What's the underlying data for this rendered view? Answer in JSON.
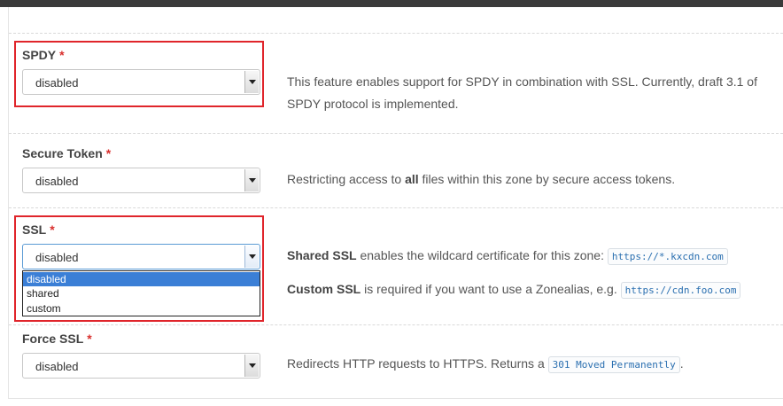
{
  "fields": {
    "spdy": {
      "label": "SPDY",
      "required_mark": "*",
      "value": "disabled",
      "description": "This feature enables support for SPDY in combination with SSL. Currently, draft 3.1 of SPDY protocol is implemented."
    },
    "secure_token": {
      "label": "Secure Token",
      "required_mark": "*",
      "value": "disabled",
      "description_pre": "Restricting access to ",
      "description_bold": "all",
      "description_post": " files within this zone by secure access tokens."
    },
    "ssl": {
      "label": "SSL",
      "required_mark": "*",
      "value": "disabled",
      "options": [
        "disabled",
        "shared",
        "custom"
      ],
      "shared_bold": "Shared SSL",
      "shared_text": " enables the wildcard certificate for this zone: ",
      "shared_code": "https://*.kxcdn.com",
      "custom_bold": "Custom SSL",
      "custom_text": " is required if you want to use a Zonealias, e.g. ",
      "custom_code": "https://cdn.foo.com"
    },
    "force_ssl": {
      "label": "Force SSL",
      "required_mark": "*",
      "value": "disabled",
      "description_pre": "Redirects HTTP requests to HTTPS. Returns a ",
      "description_code": "301 Moved Permanently",
      "description_post": "."
    }
  },
  "colors": {
    "highlight": "#e0252b",
    "required": "#d9302e",
    "selected_option": "#3b7fd6"
  }
}
